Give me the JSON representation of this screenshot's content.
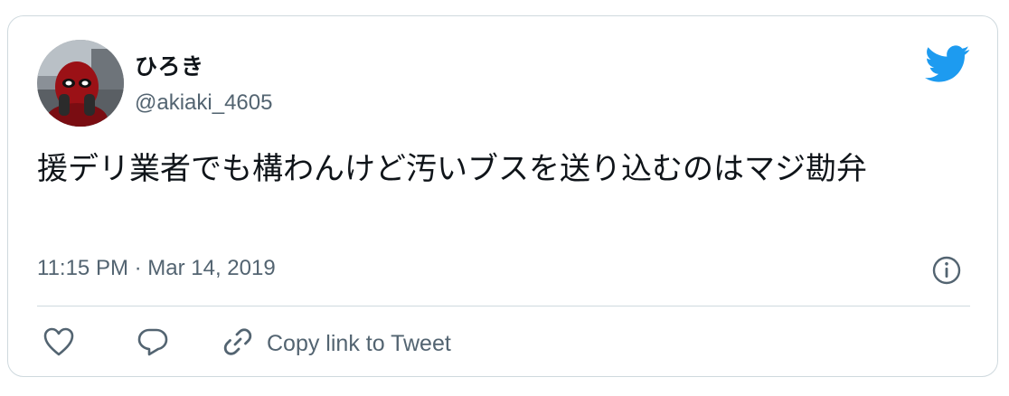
{
  "tweet": {
    "author_name": "ひろき",
    "author_handle": "@akiaki_4605",
    "text": "援デリ業者でも構わんけど汚いブスを送り込むのはマジ勘弁",
    "timestamp": "11:15 PM · Mar 14, 2019"
  },
  "actions": {
    "copy_link_label": "Copy link to Tweet"
  },
  "icons": {
    "brand": "twitter-bird-icon",
    "info": "info-icon",
    "like": "heart-icon",
    "reply": "reply-bubble-icon",
    "link": "link-icon"
  },
  "colors": {
    "brand_blue": "#1d9bf0",
    "secondary_text": "#536471",
    "border": "#cfd9de"
  }
}
